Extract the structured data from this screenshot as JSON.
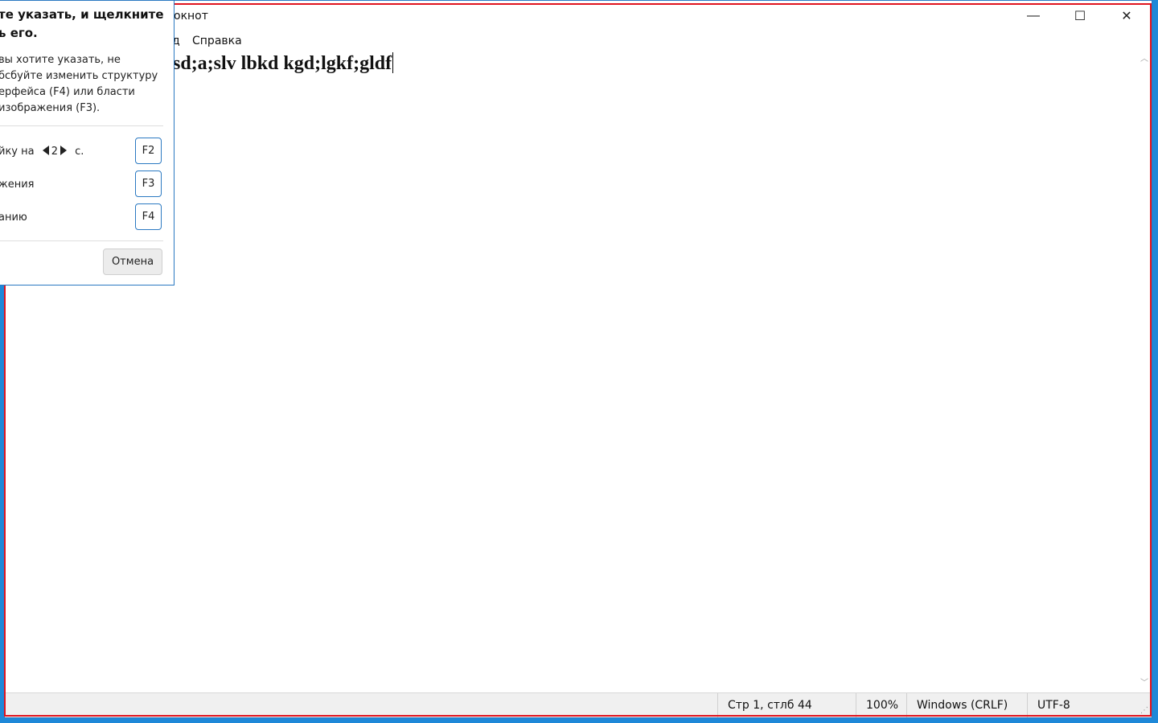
{
  "window": {
    "title": "окнот",
    "controls": {
      "minimize": "—",
      "maximize": "☐",
      "close": "✕"
    }
  },
  "menu": {
    "items": [
      {
        "label": "д"
      },
      {
        "label": "Справка"
      }
    ]
  },
  "editor": {
    "text": "sd;a;slv lbkd kgd;lgkf;gldf"
  },
  "statusbar": {
    "position": "Стр 1, стлб 44",
    "zoom": "100%",
    "line_ending": "Windows (CRLF)",
    "encoding": "UTF-8"
  },
  "snip_panel": {
    "title": "те указать, и щелкните ь его.",
    "description": "вы хотите указать, не бсбуйте изменить структуру ерфейса (F4) или бласти изображения (F3).",
    "options": [
      {
        "label_before": "йку на",
        "value": "2",
        "label_after": "с.",
        "key": "F2"
      },
      {
        "label": "жения",
        "key": "F3"
      },
      {
        "label": "анию",
        "key": "F4"
      }
    ],
    "cancel_label": "Отмена"
  },
  "colors": {
    "accent": "#2b79c2",
    "highlight_frame": "#e0141e",
    "desktop": "#1e88d8"
  }
}
